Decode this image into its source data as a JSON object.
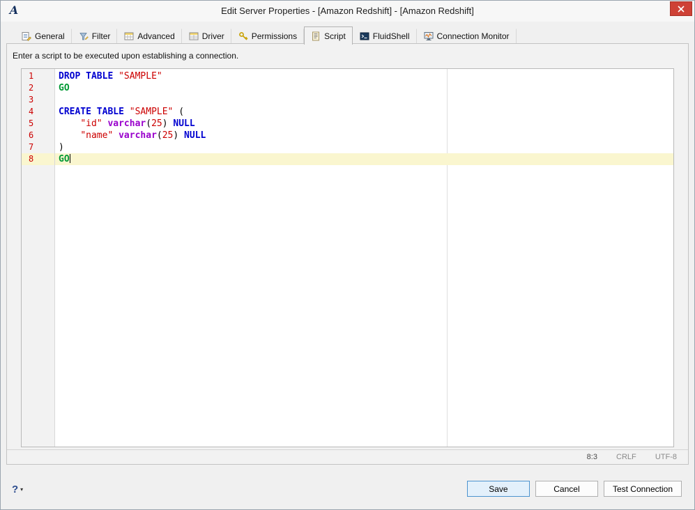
{
  "window": {
    "title": "Edit Server Properties - [Amazon Redshift] - [Amazon Redshift]",
    "app_icon": "A"
  },
  "tabs": [
    {
      "label": "General",
      "icon": "general-icon",
      "selected": false
    },
    {
      "label": "Filter",
      "icon": "filter-icon",
      "selected": false
    },
    {
      "label": "Advanced",
      "icon": "advanced-icon",
      "selected": false
    },
    {
      "label": "Driver",
      "icon": "driver-icon",
      "selected": false
    },
    {
      "label": "Permissions",
      "icon": "permissions-icon",
      "selected": false
    },
    {
      "label": "Script",
      "icon": "script-icon",
      "selected": true
    },
    {
      "label": "FluidShell",
      "icon": "fluidshell-icon",
      "selected": false
    },
    {
      "label": "Connection Monitor",
      "icon": "connection-monitor-icon",
      "selected": false
    }
  ],
  "script_panel": {
    "instruction": "Enter a script to be executed upon establishing a connection.",
    "editor": {
      "lines": [
        {
          "number": "1",
          "current": false,
          "caret_after": false,
          "tokens": [
            [
              "kw",
              "DROP"
            ],
            [
              "pl",
              " "
            ],
            [
              "kw",
              "TABLE"
            ],
            [
              "pl",
              " "
            ],
            [
              "str",
              "\"SAMPLE\""
            ]
          ]
        },
        {
          "number": "2",
          "current": false,
          "caret_after": false,
          "tokens": [
            [
              "go",
              "GO"
            ]
          ]
        },
        {
          "number": "3",
          "current": false,
          "caret_after": false,
          "tokens": []
        },
        {
          "number": "4",
          "current": false,
          "caret_after": false,
          "tokens": [
            [
              "kw",
              "CREATE"
            ],
            [
              "pl",
              " "
            ],
            [
              "kw",
              "TABLE"
            ],
            [
              "pl",
              " "
            ],
            [
              "str",
              "\"SAMPLE\""
            ],
            [
              "pl",
              " ("
            ]
          ]
        },
        {
          "number": "5",
          "current": false,
          "caret_after": false,
          "tokens": [
            [
              "pl",
              "    "
            ],
            [
              "str",
              "\"id\""
            ],
            [
              "pl",
              " "
            ],
            [
              "typ",
              "varchar"
            ],
            [
              "pl",
              "("
            ],
            [
              "num",
              "25"
            ],
            [
              "pl",
              ") "
            ],
            [
              "kw",
              "NULL"
            ]
          ]
        },
        {
          "number": "6",
          "current": false,
          "caret_after": false,
          "tokens": [
            [
              "pl",
              "    "
            ],
            [
              "str",
              "\"name\""
            ],
            [
              "pl",
              " "
            ],
            [
              "typ",
              "varchar"
            ],
            [
              "pl",
              "("
            ],
            [
              "num",
              "25"
            ],
            [
              "pl",
              ") "
            ],
            [
              "kw",
              "NULL"
            ]
          ]
        },
        {
          "number": "7",
          "current": false,
          "caret_after": false,
          "tokens": [
            [
              "pl",
              ")"
            ]
          ]
        },
        {
          "number": "8",
          "current": true,
          "caret_after": true,
          "tokens": [
            [
              "go",
              "GO"
            ]
          ]
        }
      ]
    },
    "status": {
      "caret_position": "8:3",
      "line_ending": "CRLF",
      "encoding": "UTF-8"
    }
  },
  "footer": {
    "help_label": "?",
    "buttons": [
      {
        "label": "Save",
        "default": true
      },
      {
        "label": "Cancel",
        "default": false
      },
      {
        "label": "Test Connection",
        "default": false
      }
    ]
  },
  "colors": {
    "keyword": "#0000d0",
    "string": "#cc0000",
    "go_keyword": "#009933",
    "datatype": "#9900cc",
    "number": "#cc0000",
    "line_number": "#cc0000",
    "current_line_bg": "#faf6cf",
    "close_button_bg": "#ce4136",
    "save_button_border": "#4c93cf"
  }
}
